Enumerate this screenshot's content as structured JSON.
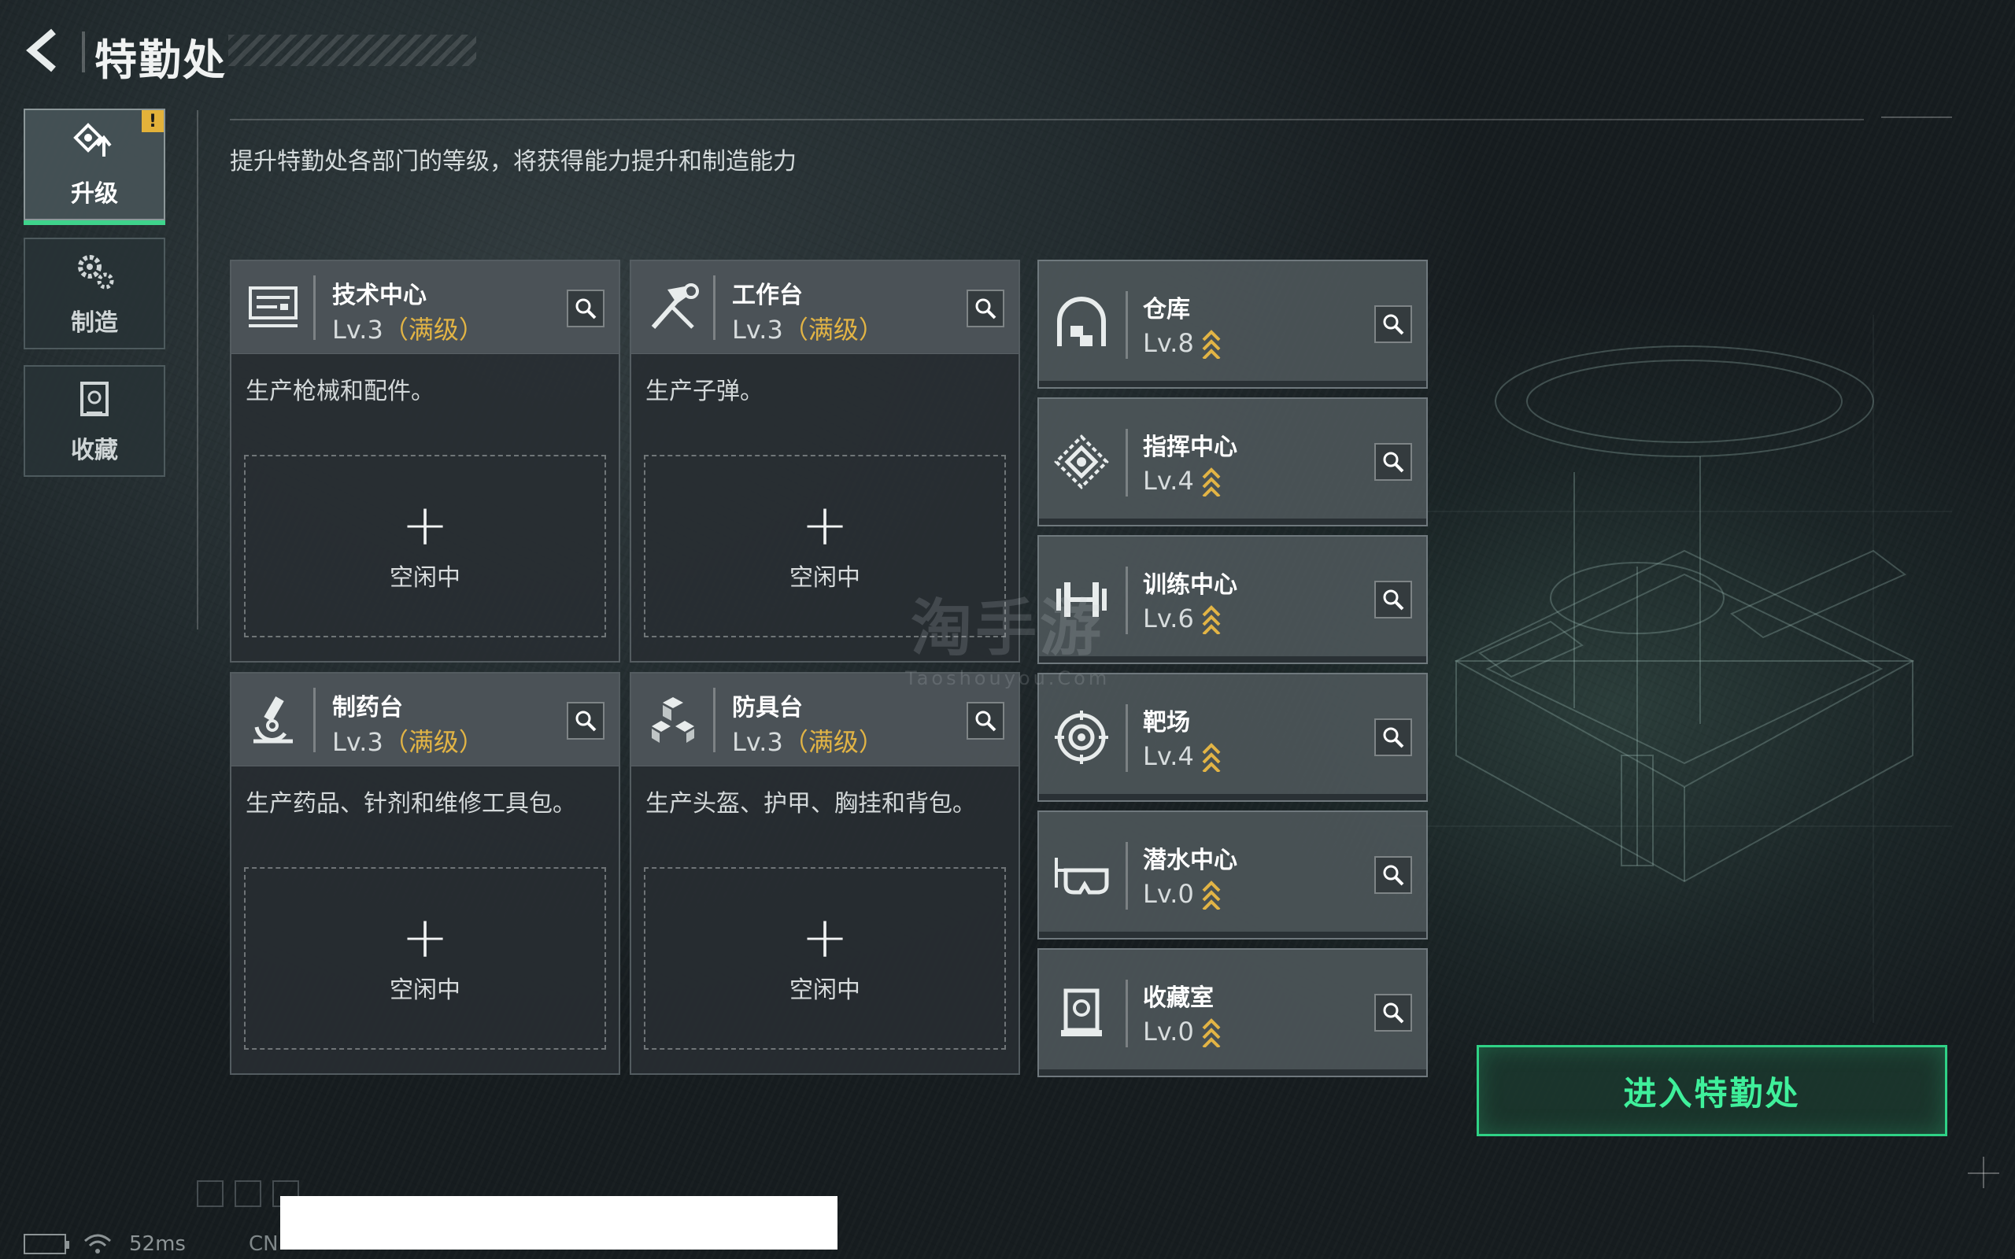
{
  "header": {
    "title": "特勤处"
  },
  "sidebar": {
    "tabs": [
      {
        "label": "升级",
        "icon": "upgrade-icon",
        "active": true,
        "alert": "!"
      },
      {
        "label": "制造",
        "icon": "gears-icon",
        "active": false
      },
      {
        "label": "收藏",
        "icon": "collection-icon",
        "active": false
      }
    ]
  },
  "main": {
    "description": "提升特勤处各部门的等级，将获得能力提升和制造能力",
    "departments": [
      {
        "name": "技术中心",
        "level": "Lv.3",
        "max_label": "（满级）",
        "desc": "生产枪械和配件。",
        "slot_plus": "+",
        "slot_status": "空闲中",
        "icon": "tech-center-icon"
      },
      {
        "name": "工作台",
        "level": "Lv.3",
        "max_label": "（满级）",
        "desc": "生产子弹。",
        "slot_plus": "+",
        "slot_status": "空闲中",
        "icon": "hammer-wrench-icon"
      },
      {
        "name": "制药台",
        "level": "Lv.3",
        "max_label": "（满级）",
        "desc": "生产药品、针剂和维修工具包。",
        "slot_plus": "+",
        "slot_status": "空闲中",
        "icon": "microscope-icon"
      },
      {
        "name": "防具台",
        "level": "Lv.3",
        "max_label": "（满级）",
        "desc": "生产头盔、护甲、胸挂和背包。",
        "slot_plus": "+",
        "slot_status": "空闲中",
        "icon": "cubes-icon"
      }
    ],
    "facilities": [
      {
        "name": "仓库",
        "level": "Lv.8",
        "icon": "warehouse-icon"
      },
      {
        "name": "指挥中心",
        "level": "Lv.4",
        "icon": "command-center-icon"
      },
      {
        "name": "训练中心",
        "level": "Lv.6",
        "icon": "dumbbell-icon"
      },
      {
        "name": "靶场",
        "level": "Lv.4",
        "icon": "target-icon"
      },
      {
        "name": "潜水中心",
        "level": "Lv.0",
        "icon": "diving-mask-icon"
      },
      {
        "name": "收藏室",
        "level": "Lv.0",
        "icon": "collection-room-icon"
      }
    ],
    "enter_button": "进入特勤处"
  },
  "footer": {
    "ping": "52ms",
    "client_id_prefix": "CN"
  },
  "watermark": {
    "main": "淘手游",
    "sub": "Taoshouyou.Com"
  },
  "colors": {
    "accent_green": "#3ff09b",
    "max_level_gold": "#e2b445",
    "alert_yellow": "#e3b23a"
  }
}
